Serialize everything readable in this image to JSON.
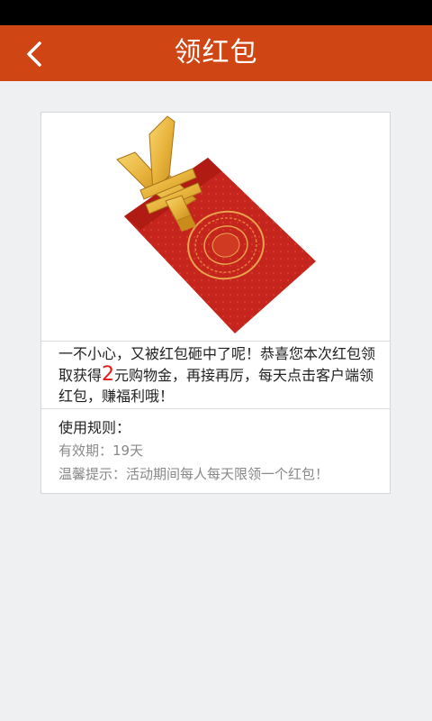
{
  "header": {
    "title": "领红包"
  },
  "message": {
    "before": "一不小心，又被红包砸中了呢！恭喜您本次红包领取获得",
    "amount": "2",
    "after": "元购物金，再接再厉，每天点击客户端领红包，赚福利哦！"
  },
  "rules": {
    "title": "使用规则：",
    "validity": "有效期：19天",
    "tip": "温馨提示：活动期间每人每天限领一个红包！"
  },
  "colors": {
    "header": "#cf4514",
    "amount": "#e51a1a",
    "envelope": "#c5251c",
    "gold": "#e8b43c"
  }
}
